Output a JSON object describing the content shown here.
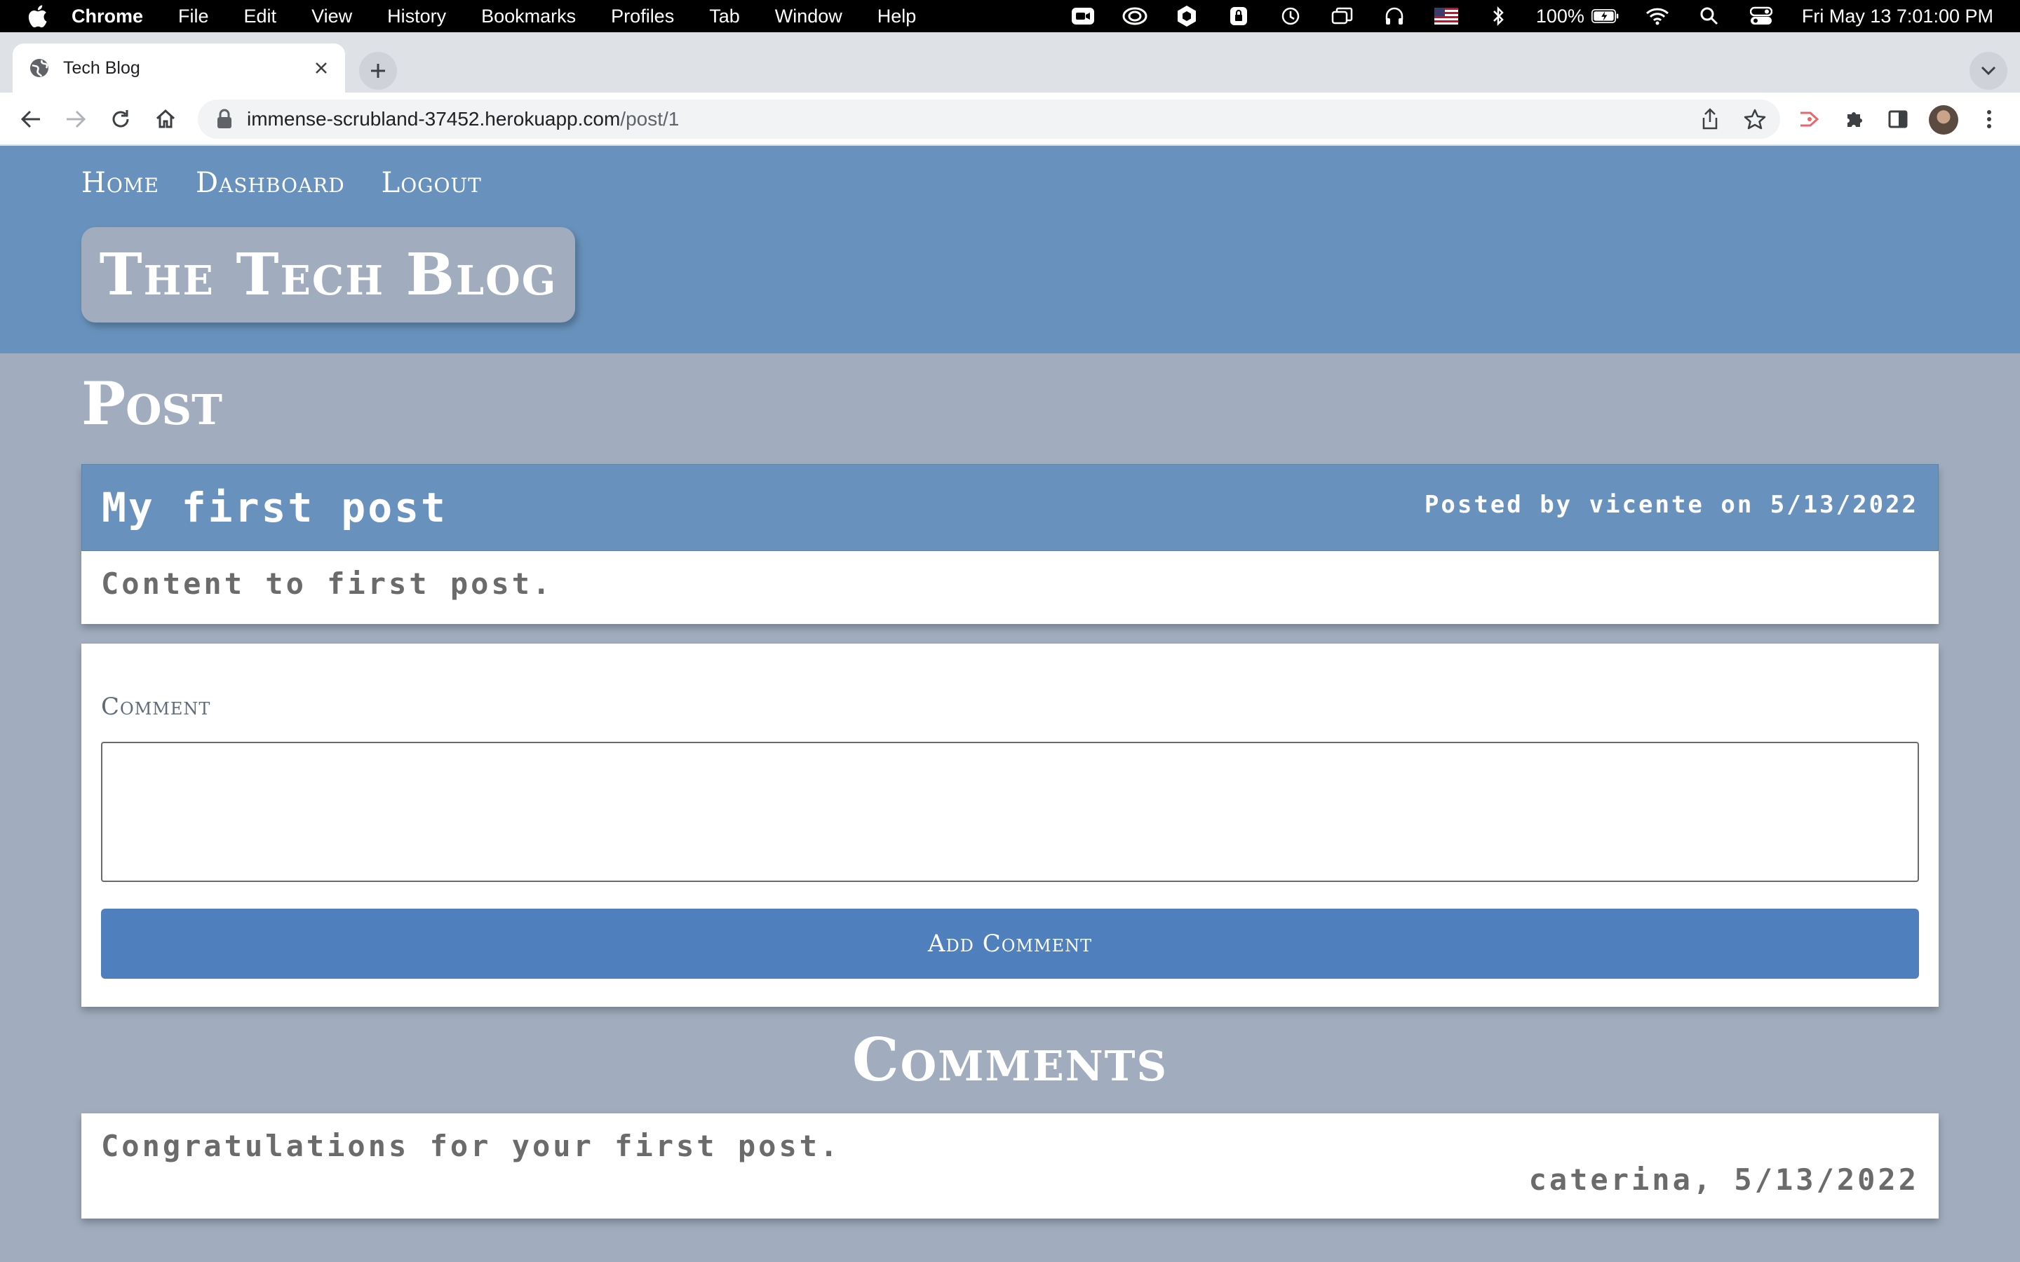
{
  "menubar": {
    "app_name": "Chrome",
    "menus": [
      "File",
      "Edit",
      "View",
      "History",
      "Bookmarks",
      "Profiles",
      "Tab",
      "Window",
      "Help"
    ],
    "battery": "100%",
    "clock": "Fri May 13  7:01:00 PM"
  },
  "browser": {
    "tab_title": "Tech Blog",
    "url_host": "immense-scrubland-37452.herokuapp.com",
    "url_path": "/post/1"
  },
  "site": {
    "nav": {
      "home": "Home",
      "dashboard": "Dashboard",
      "logout": "Logout"
    },
    "brand": "The Tech Blog",
    "page_title": "Post",
    "post": {
      "title": "My first post",
      "meta": "Posted by vicente on 5/13/2022",
      "content": "Content to first post."
    },
    "comment_form": {
      "label": "Comment",
      "value": "",
      "button": "Add Comment"
    },
    "comments_heading": "Comments",
    "comments": [
      {
        "text": "Congratulations for your first post.",
        "meta": "caterina, 5/13/2022"
      }
    ]
  },
  "colors": {
    "header_blue": "#6892bd",
    "page_bg": "#a1adbe",
    "button_blue": "#4f7fbc"
  }
}
